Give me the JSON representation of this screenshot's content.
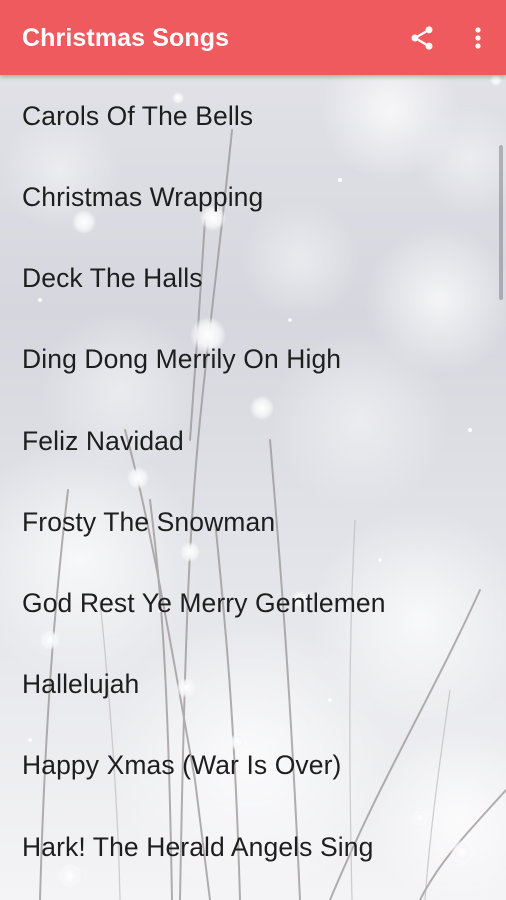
{
  "app_bar": {
    "title": "Christmas Songs",
    "accent_color": "#ef5a5f",
    "share_icon": "share-icon",
    "more_icon": "more-vert-icon"
  },
  "songs": [
    {
      "title": "Carols Of The Bells"
    },
    {
      "title": "Christmas Wrapping"
    },
    {
      "title": "Deck The Halls"
    },
    {
      "title": "Ding Dong Merrily On High"
    },
    {
      "title": "Feliz Navidad"
    },
    {
      "title": "Frosty The Snowman"
    },
    {
      "title": "God Rest Ye Merry Gentlemen"
    },
    {
      "title": "Hallelujah"
    },
    {
      "title": "Happy Xmas (War Is Over)"
    },
    {
      "title": "Hark! The Herald Angels Sing"
    }
  ]
}
